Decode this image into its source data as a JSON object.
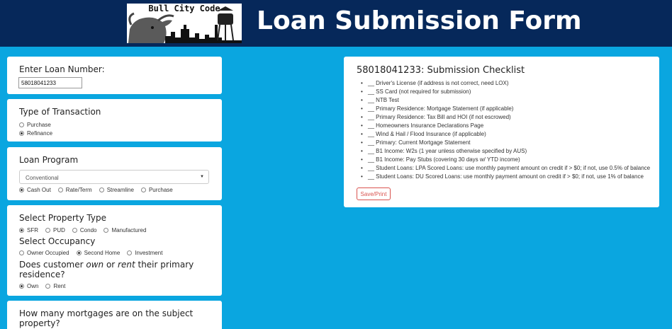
{
  "header": {
    "logo_text": "Bull City Code",
    "title": "Loan Submission Form"
  },
  "loan_number": {
    "label": "Enter Loan Number:",
    "value": "58018041233"
  },
  "transaction": {
    "label": "Type of Transaction",
    "options": [
      {
        "label": "Purchase",
        "selected": false
      },
      {
        "label": "Refinance",
        "selected": true
      }
    ]
  },
  "program": {
    "label": "Loan Program",
    "selected": "Conventional",
    "options": [
      {
        "label": "Cash Out",
        "selected": true
      },
      {
        "label": "Rate/Term",
        "selected": false
      },
      {
        "label": "Streamline",
        "selected": false
      },
      {
        "label": "Purchase",
        "selected": false
      }
    ]
  },
  "property": {
    "type_label": "Select Property Type",
    "types": [
      {
        "label": "SFR",
        "selected": true
      },
      {
        "label": "PUD",
        "selected": false
      },
      {
        "label": "Condo",
        "selected": false
      },
      {
        "label": "Manufactured",
        "selected": false
      }
    ],
    "occupancy_label": "Select Occupancy",
    "occupancy": [
      {
        "label": "Owner Occupied",
        "selected": false
      },
      {
        "label": "Second Home",
        "selected": true
      },
      {
        "label": "Investment",
        "selected": false
      }
    ],
    "residence_q_prefix": "Does customer ",
    "residence_q_own": "own",
    "residence_q_or": " or ",
    "residence_q_rent": "rent",
    "residence_q_suffix": " their primary residence?",
    "residence": [
      {
        "label": "Own",
        "selected": true
      },
      {
        "label": "Rent",
        "selected": false
      }
    ]
  },
  "mortgages": {
    "label": "How many mortgages are on the subject property?"
  },
  "checklist": {
    "title": "58018041233: Submission Checklist",
    "items": [
      "__ Driver's License (if address is not correct, need LOX)",
      "__ SS Card (not required for submission)",
      "__ NTB Test",
      "__ Primary Residence: Mortgage Statement (if applicable)",
      "__ Primary Residence: Tax Bill and HOI (if not escrowed)",
      "__ Homeowners Insurance Declarations Page",
      "__ Wind & Hail / Flood Insurance (if applicable)",
      "__ Primary: Current Mortgage Statement",
      "__ B1 Income: W2s (1 year unless otherwise specified by AUS)",
      "__ B1 Income: Pay Stubs (covering 30 days w/ YTD income)",
      "__ Student Loans: LPA Scored Loans: use monthly payment amount on credit if > $0; if not, use 0.5% of balance",
      "__ Student Loans: DU Scored Loans: use monthly payment amount on credit if > $0; if not, use 1% of balance"
    ],
    "button": "Save/Print"
  },
  "colors": {
    "page_bg": "#0aa6e0",
    "header_bg": "#06285a",
    "button_accent": "#d9534f"
  }
}
